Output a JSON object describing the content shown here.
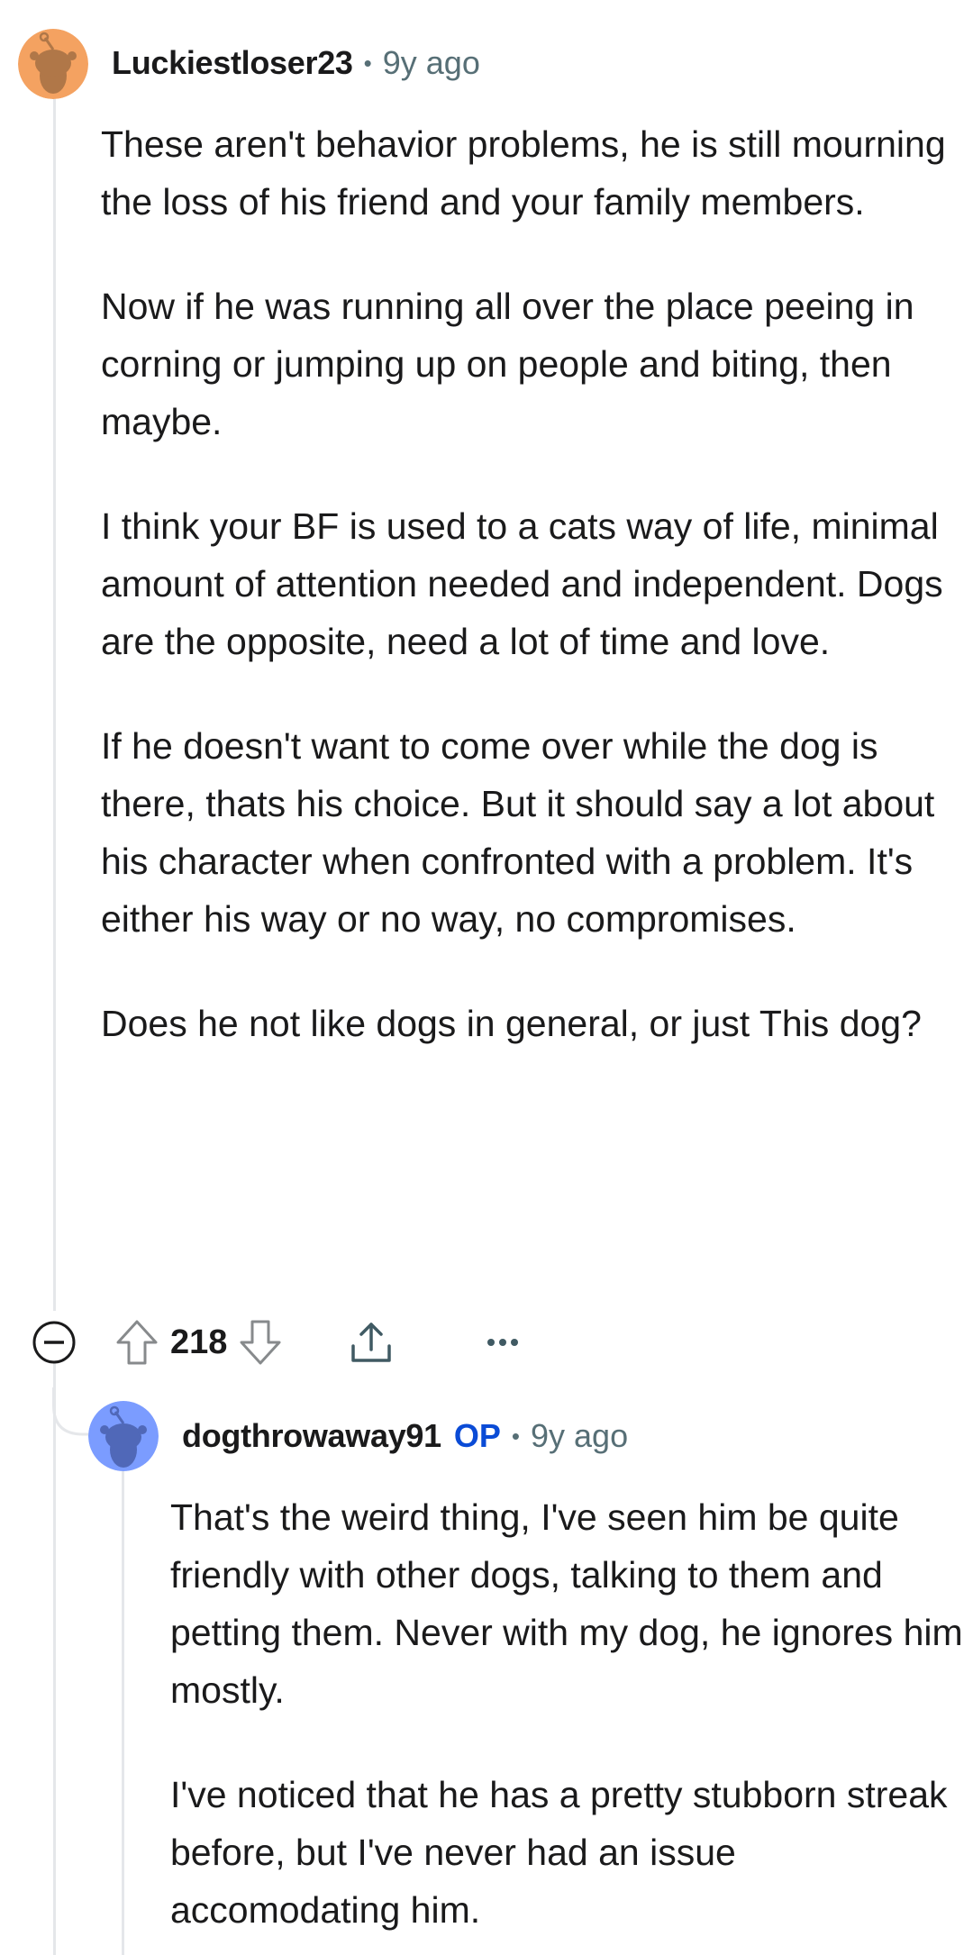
{
  "comment": {
    "username": "Luckiestloser23",
    "separator": "•",
    "time": "9y ago",
    "paragraphs": [
      "These aren't behavior problems, he is still mourning the loss of his friend and your family members.",
      "Now if he was running all over the place peeing in corning or jumping up on people and biting, then maybe.",
      "I think your BF is used to a cats way of life, minimal amount of attention needed and independent. Dogs are the opposite, need a lot of time and love.",
      "If he doesn't want to come over while the dog is there, thats his choice. But it should say a lot about his character when confronted with a problem. It's either his way or no way, no compromises.",
      "Does he not like dogs in general, or just This dog?"
    ],
    "score": "218",
    "more_label": "•••",
    "avatar_color": "#f4a261"
  },
  "reply": {
    "username": "dogthrowaway91",
    "op_badge": "OP",
    "separator": "•",
    "time": "9y ago",
    "paragraphs": [
      "That's the weird thing, I've seen him be quite friendly with other dogs, talking to them and petting them. Never with my dog, he ignores him mostly.",
      "I've noticed that he has a pretty stubborn streak before, but I've never had an issue accomodating him."
    ],
    "avatar_color": "#7b9cff"
  },
  "icons": {
    "collapse": "collapse-minus-icon",
    "upvote": "upvote-arrow-icon",
    "downvote": "downvote-arrow-icon",
    "share": "share-icon",
    "more": "more-options-icon"
  },
  "colors": {
    "text": "#1a1a1b",
    "meta": "#576f76",
    "op": "#0a4bd6",
    "thread_line": "#e5e7ea"
  }
}
